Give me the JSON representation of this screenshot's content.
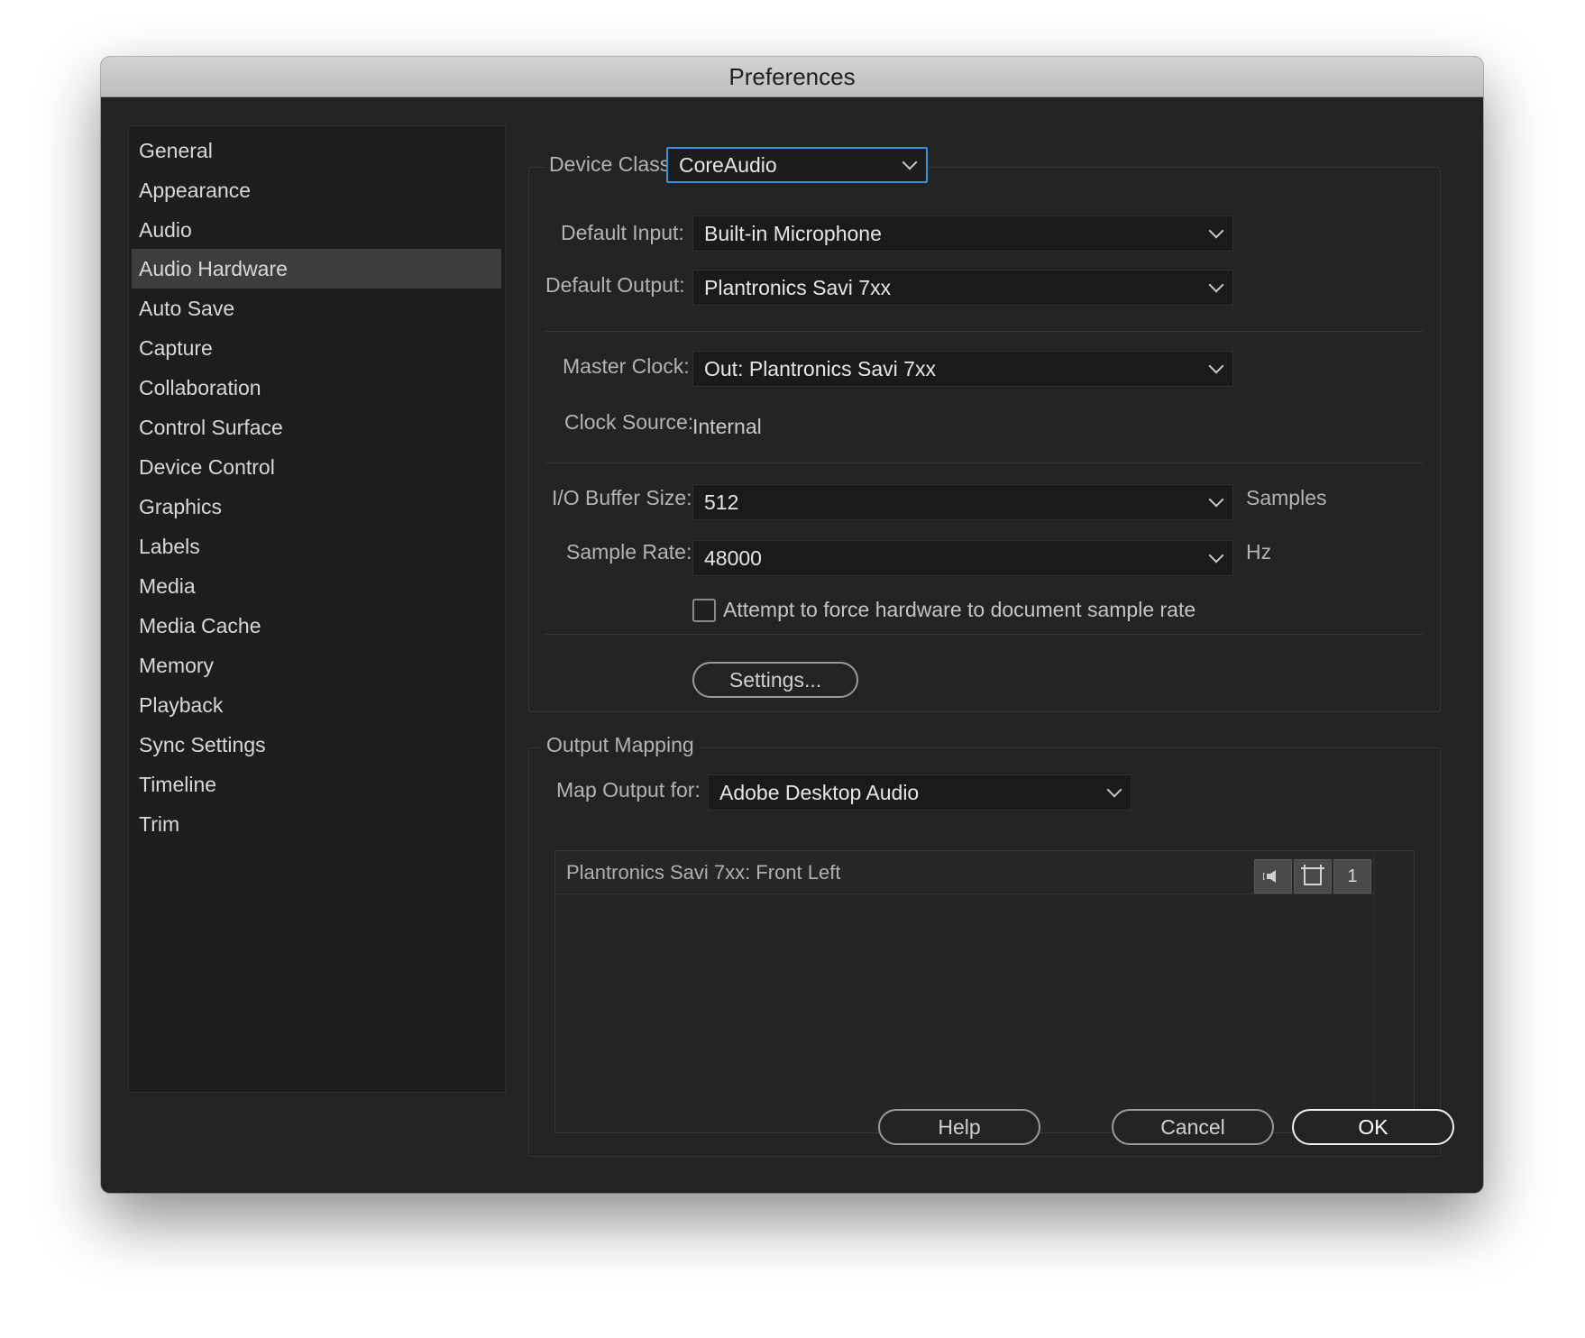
{
  "window": {
    "title": "Preferences"
  },
  "sidebar": {
    "items": [
      {
        "label": "General"
      },
      {
        "label": "Appearance"
      },
      {
        "label": "Audio"
      },
      {
        "label": "Audio Hardware",
        "selected": true
      },
      {
        "label": "Auto Save"
      },
      {
        "label": "Capture"
      },
      {
        "label": "Collaboration"
      },
      {
        "label": "Control Surface"
      },
      {
        "label": "Device Control"
      },
      {
        "label": "Graphics"
      },
      {
        "label": "Labels"
      },
      {
        "label": "Media"
      },
      {
        "label": "Media Cache"
      },
      {
        "label": "Memory"
      },
      {
        "label": "Playback"
      },
      {
        "label": "Sync Settings"
      },
      {
        "label": "Timeline"
      },
      {
        "label": "Trim"
      }
    ]
  },
  "device": {
    "class_label": "Device Class:",
    "class_value": "CoreAudio",
    "default_input_label": "Default Input:",
    "default_input_value": "Built-in Microphone",
    "default_output_label": "Default Output:",
    "default_output_value": "Plantronics Savi 7xx",
    "master_clock_label": "Master Clock:",
    "master_clock_value": "Out: Plantronics Savi 7xx",
    "clock_source_label": "Clock Source:",
    "clock_source_value": "Internal",
    "buffer_label": "I/O Buffer Size:",
    "buffer_value": "512",
    "buffer_unit": "Samples",
    "sample_rate_label": "Sample Rate:",
    "sample_rate_value": "48000",
    "sample_rate_unit": "Hz",
    "force_rate_label": "Attempt to force hardware to document sample rate",
    "force_rate_checked": false,
    "settings_button": "Settings..."
  },
  "output_mapping": {
    "group_label": "Output Mapping",
    "map_for_label": "Map Output for:",
    "map_for_value": "Adobe Desktop Audio",
    "channel_label": "Plantronics Savi 7xx:  Front Left",
    "channel_number": "1"
  },
  "footer": {
    "help": "Help",
    "cancel": "Cancel",
    "ok": "OK"
  },
  "colors": {
    "accent_focus": "#3b8fe0",
    "window_bg": "#232323",
    "selected_item_bg": "#3d3d3d"
  }
}
